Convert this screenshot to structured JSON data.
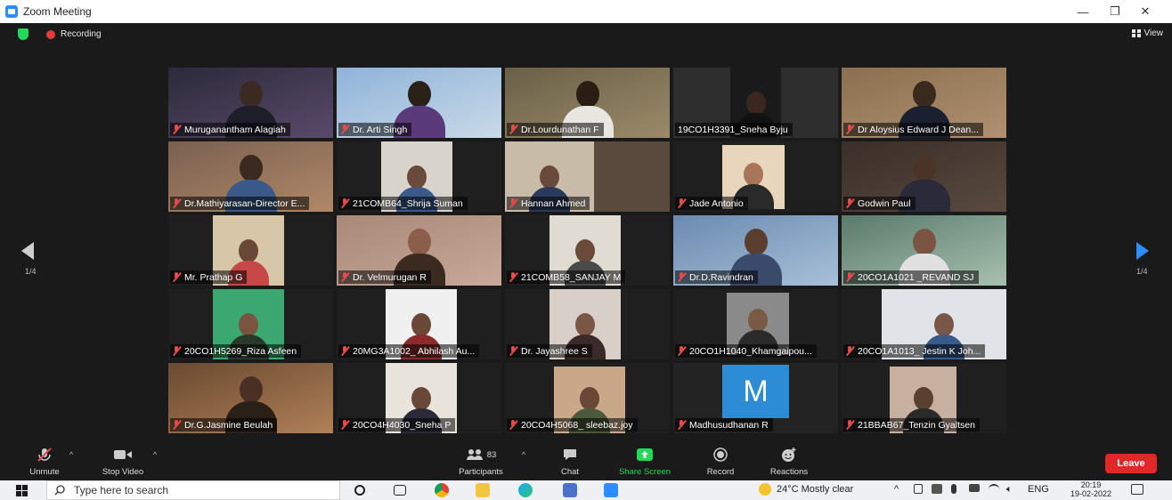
{
  "window": {
    "title": "Zoom Meeting",
    "minimize": "—",
    "restore": "❐",
    "close": "✕"
  },
  "topbar": {
    "recording_label": "Recording",
    "view_label": "View"
  },
  "nav": {
    "page_left": "1/4",
    "page_right": "1/4"
  },
  "participants": [
    {
      "name": "Muruganantham Alagiah",
      "muted": true
    },
    {
      "name": "Dr. Arti Singh",
      "muted": true,
      "active": true
    },
    {
      "name": "Dr.Lourdunathan F",
      "muted": true
    },
    {
      "name": "19CO1H3391_Sneha Byju",
      "muted": false
    },
    {
      "name": "Dr Aloysius Edward J Dean...",
      "muted": true
    },
    {
      "name": "Dr.Mathiyarasan-Director E...",
      "muted": true
    },
    {
      "name": "21COMB64_Shrija Suman",
      "muted": true
    },
    {
      "name": "Hannan Ahmed",
      "muted": true
    },
    {
      "name": "Jade Antonio",
      "muted": true
    },
    {
      "name": "Godwin Paul",
      "muted": true
    },
    {
      "name": "Mr. Prathap G",
      "muted": true
    },
    {
      "name": "Dr. Velmurugan R",
      "muted": true
    },
    {
      "name": "21COMB58_SANJAY M",
      "muted": true
    },
    {
      "name": "Dr.D.Ravindran",
      "muted": true
    },
    {
      "name": "20CO1A1021 _REVAND SJ",
      "muted": true
    },
    {
      "name": "20CO1H5269_Riza Asfeen",
      "muted": true
    },
    {
      "name": "20MG3A1002_ Abhilash Au...",
      "muted": true
    },
    {
      "name": "Dr. Jayashree S",
      "muted": true
    },
    {
      "name": "20CO1H1040_Khamgaipou...",
      "muted": true
    },
    {
      "name": "20CO1A1013_ Jestin K Joh...",
      "muted": true
    },
    {
      "name": "Dr.G.Jasmine Beulah",
      "muted": true
    },
    {
      "name": "20CO4H4030_Sneha P",
      "muted": true
    },
    {
      "name": "20CO4H5068_ sleebaz.joy",
      "muted": true
    },
    {
      "name": "Madhusudhanan R",
      "muted": true,
      "avatar_letter": "M"
    },
    {
      "name": "21BBAB67_Tenzin Gyaltsen",
      "muted": true
    }
  ],
  "toolbar": {
    "unmute": "Unmute",
    "stop_video": "Stop Video",
    "participants": "Participants",
    "participants_count": "83",
    "chat": "Chat",
    "share_screen": "Share Screen",
    "record": "Record",
    "reactions": "Reactions",
    "leave": "Leave"
  },
  "taskbar": {
    "search_placeholder": "Type here to search",
    "weather": "24°C  Mostly clear",
    "language": "ENG",
    "time": "20:19",
    "date": "19-02-2022"
  },
  "colors": {
    "accent_green": "#23d959",
    "active_border": "#c4d93a",
    "share_green": "#23d959",
    "leave_red": "#e02828",
    "zoom_blue": "#2d8cff"
  }
}
